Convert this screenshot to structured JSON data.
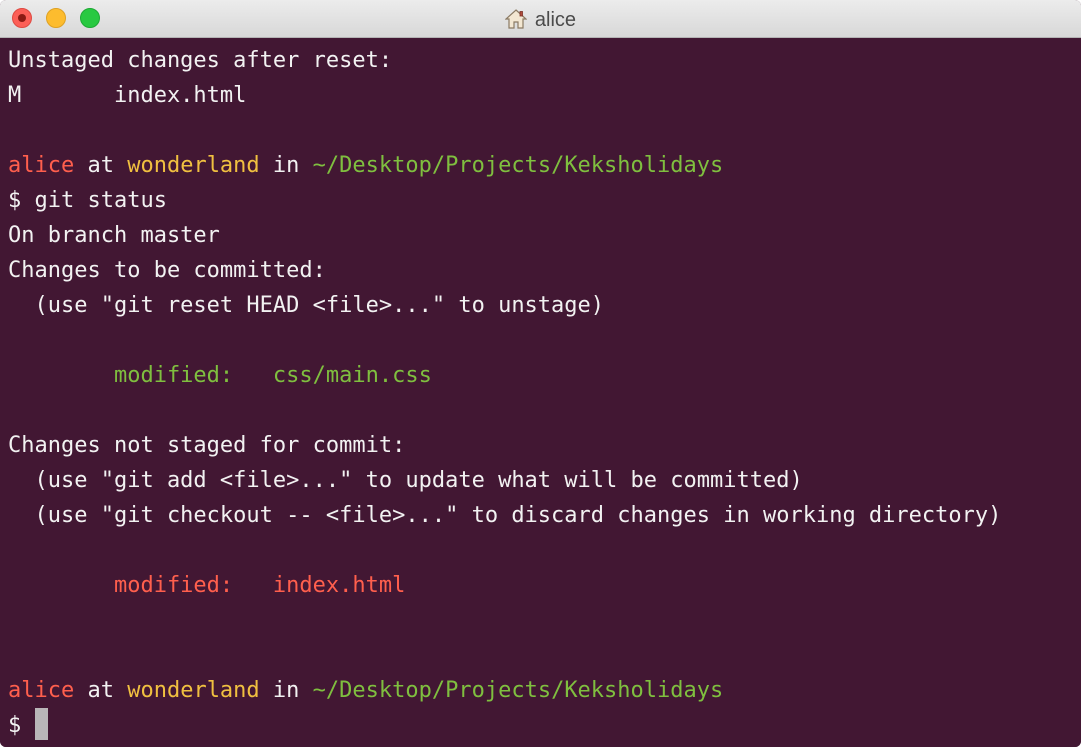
{
  "window": {
    "title": "alice",
    "title_icon": "home-icon"
  },
  "terminal": {
    "lines": [
      {
        "text": "Unstaged changes after reset:"
      },
      {
        "text": "M       index.html"
      },
      {
        "text": ""
      },
      {
        "prompt": {
          "user": "alice",
          "at": " at ",
          "host": "wonderland",
          "in": " in ",
          "path": "~/Desktop/Projects/Keksholidays"
        }
      },
      {
        "text": "$ git status"
      },
      {
        "text": "On branch master"
      },
      {
        "text": "Changes to be committed:"
      },
      {
        "text": "  (use \"git reset HEAD <file>...\" to unstage)"
      },
      {
        "text": ""
      },
      {
        "staged": {
          "label": "        modified:   ",
          "file": "css/main.css"
        }
      },
      {
        "text": ""
      },
      {
        "text": "Changes not staged for commit:"
      },
      {
        "text": "  (use \"git add <file>...\" to update what will be committed)"
      },
      {
        "text": "  (use \"git checkout -- <file>...\" to discard changes in working directory)"
      },
      {
        "text": ""
      },
      {
        "unstaged": {
          "label": "        modified:   ",
          "file": "index.html"
        }
      },
      {
        "text": ""
      },
      {
        "text": ""
      },
      {
        "prompt": {
          "user": "alice",
          "at": " at ",
          "host": "wonderland",
          "in": " in ",
          "path": "~/Desktop/Projects/Keksholidays"
        }
      },
      {
        "text": "$ "
      }
    ]
  },
  "colors": {
    "background": "#421733",
    "text": "#f2f2f2",
    "user": "#ff5f4d",
    "host": "#f0c040",
    "path": "#7fbf3f",
    "staged": "#7fbf3f",
    "unstaged": "#ff5f4d"
  }
}
